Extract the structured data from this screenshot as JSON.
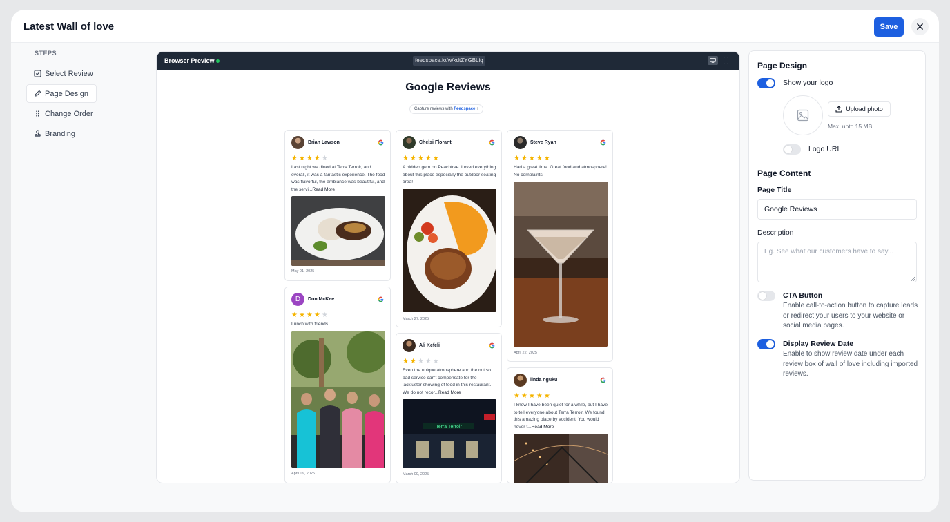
{
  "app": {
    "title": "Latest Wall of love",
    "save_label": "Save"
  },
  "steps": {
    "label": "STEPS",
    "items": [
      {
        "label": "Select Review",
        "icon": "checkbox-icon"
      },
      {
        "label": "Page Design",
        "icon": "pencil-icon",
        "active": true
      },
      {
        "label": "Change Order",
        "icon": "drag-handle-icon"
      },
      {
        "label": "Branding",
        "icon": "stamp-icon"
      }
    ]
  },
  "preview": {
    "label": "Browser Preview",
    "url": "feedspace.io/w/kdtZYGBLiq",
    "title": "Google Reviews",
    "capture_prefix": "Capture reviews with",
    "capture_brand": "Feedspace",
    "capture_suffix": "↑",
    "reviews": [
      {
        "name": "Brian Lawson",
        "rating": 4,
        "text": "Last night we dined at Terra Terroir, and overall, it was a fantastic experience. The food was flavorful, the ambiance was beautiful, and the servi...",
        "more": "Read More",
        "date": "May 01, 2025"
      },
      {
        "name": "Don McKee",
        "initial": "D",
        "rating": 4,
        "text": "Lunch with friends",
        "date": "April 09, 2025"
      },
      {
        "name": "Chelsi Florant",
        "rating": 5,
        "text": "A hidden gem on Peachtree. Loved everything about this place especially the outdoor seating area!",
        "date": "March 27, 2025"
      },
      {
        "name": "Ali Kefeli",
        "rating": 2,
        "text": "Even the unique atmosphere and the not so bad service can't compensate for the lackluster showing of food in this restaurant. We do not recor...",
        "more": "Read More",
        "date": "March 09, 2025",
        "photo_sign": "Terra Terroir"
      },
      {
        "name": "Steve Ryan",
        "rating": 5,
        "text": "Had a great time. Great food and atmosphere! No complaints.",
        "date": "April 22, 2025"
      },
      {
        "name": "linda nguku",
        "rating": 5,
        "text": "I know I have been quiet for a while, but I have to tell everyone about Terra Terroir. We found this amazing place by accident. You would never t...",
        "more": "Read More"
      }
    ]
  },
  "settings": {
    "page_design": {
      "title": "Page Design",
      "show_logo_label": "Show your logo",
      "show_logo_on": true,
      "upload_label": "Upload photo",
      "max_note": "Max. upto 15 MB",
      "logo_url_label": "Logo URL",
      "logo_url_on": false
    },
    "page_content": {
      "title": "Page Content",
      "page_title_label": "Page Title",
      "page_title_value": "Google Reviews",
      "description_label": "Description",
      "description_placeholder": "Eg. See what our customers have to say...",
      "cta_label": "CTA Button",
      "cta_on": false,
      "cta_desc": "Enable call-to-action button to capture leads or redirect your users to your website or social media pages.",
      "date_label": "Display Review Date",
      "date_on": true,
      "date_desc": "Enable to show review date under each review box of wall of love including imported reviews."
    }
  },
  "colors": {
    "accent": "#1d5fe0",
    "star": "#f5b400",
    "browser_bar": "#1f2937"
  }
}
